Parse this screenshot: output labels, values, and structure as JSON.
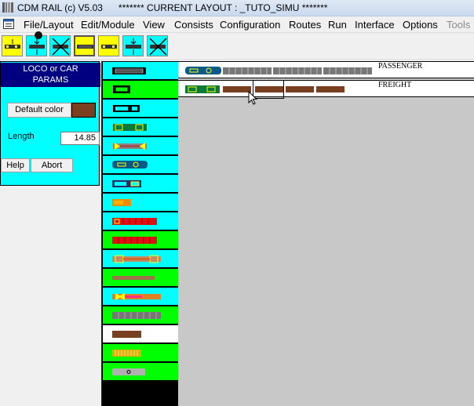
{
  "window": {
    "title": "CDM RAIL (c) V5.03      ******* CURRENT LAYOUT : _TUTO_SIMU *******"
  },
  "menu": {
    "items": [
      "File/Layout",
      "Edit/Module",
      "View",
      "Consists",
      "Configuration",
      "Routes",
      "Run",
      "Interface",
      "Options",
      "Tools"
    ]
  },
  "toolbar": {
    "buttons": [
      "car-left-icon",
      "uncouple-icon",
      "delete-cross-icon",
      "car-selected-icon",
      "car-yellow-icon",
      "car-remove-icon",
      "car-remove-cross-icon"
    ]
  },
  "params": {
    "title_line1": "LOCO or CAR",
    "title_line2": "PARAMS",
    "default_color_label": "Default color",
    "default_color_value": "#7a3f1e",
    "length_label": "Length",
    "length_value": "14.85",
    "help_label": "Help",
    "abort_label": "Abort"
  },
  "palette": {
    "items": [
      {
        "name": "loco-diesel-black",
        "bg": "#00ffff"
      },
      {
        "name": "loco-switcher-black",
        "bg": "#00ff00"
      },
      {
        "name": "loco-switcher-outline",
        "bg": "#00ffff"
      },
      {
        "name": "car-green-yellow-trucks",
        "bg": "#00ffff"
      },
      {
        "name": "car-gray-yellow-ends",
        "bg": "#00ffff"
      },
      {
        "name": "loco-blue-windows",
        "bg": "#00ffff"
      },
      {
        "name": "car-cyan-outline",
        "bg": "#00ffff"
      },
      {
        "name": "car-orange-short",
        "bg": "#00ffff"
      },
      {
        "name": "car-red-dashed",
        "bg": "#00ffff"
      },
      {
        "name": "car-red-blocks",
        "bg": "#00ff00"
      },
      {
        "name": "car-orange-yellow-trucks",
        "bg": "#00ffff"
      },
      {
        "name": "car-brown-flat",
        "bg": "#00ff00"
      },
      {
        "name": "car-orange-pink-trucks",
        "bg": "#00ffff"
      },
      {
        "name": "car-gray-dashed",
        "bg": "#00ff00"
      },
      {
        "name": "car-brown-box",
        "bg": "#ffffff"
      },
      {
        "name": "car-yellow-hopper",
        "bg": "#00ff00"
      },
      {
        "name": "car-gray-single",
        "bg": "#00ff00"
      }
    ]
  },
  "consists": [
    {
      "label": "PASSENGER"
    },
    {
      "label": "FREIGHT"
    }
  ]
}
